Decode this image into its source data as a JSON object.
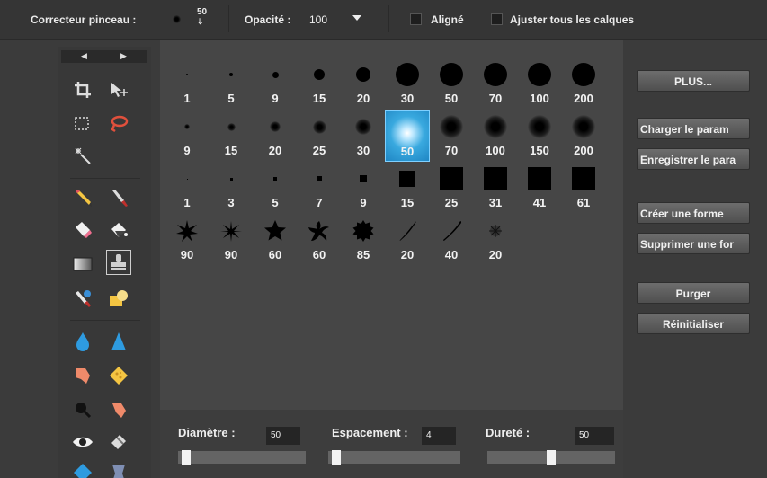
{
  "options_bar": {
    "brush_label": "Correcteur pinceau :",
    "brush_size": "50",
    "brush_size_arrow": "⇓",
    "opacity_label": "Opacité :",
    "opacity_value": "100",
    "aligned_label": "Aligné",
    "aligned_checked": false,
    "all_layers_label": "Ajuster tous les calques",
    "all_layers_checked": false
  },
  "tools_panel": {
    "arrow_left": "◀",
    "arrow_right": "▶",
    "tools": [
      "crop-icon",
      "move-icon",
      "marquee-icon",
      "lasso-icon",
      "magic-wand-icon",
      "pencil-icon",
      "brush-icon",
      "eraser-icon",
      "paint-bucket-icon",
      "gradient-icon",
      "clone-stamp-icon",
      "color-replace-icon",
      "shape-icon",
      "blur-drop-icon",
      "sharpen-icon",
      "smudge-hand-icon",
      "sponge-icon",
      "dodge-icon",
      "burn-icon",
      "red-eye-icon",
      "spot-heal-icon"
    ],
    "selected_tool": "clone-stamp-icon"
  },
  "brushes": {
    "rows": [
      {
        "kind": "hard-round",
        "sizes": [
          "1",
          "5",
          "9",
          "15",
          "20",
          "30",
          "50",
          "70",
          "100",
          "200"
        ]
      },
      {
        "kind": "soft-round",
        "sizes": [
          "9",
          "15",
          "20",
          "25",
          "30",
          "50",
          "70",
          "100",
          "150",
          "200"
        ]
      },
      {
        "kind": "square",
        "sizes": [
          "1",
          "3",
          "5",
          "7",
          "9",
          "15",
          "25",
          "31",
          "41",
          "61"
        ]
      },
      {
        "kind": "special",
        "sizes": [
          "90",
          "90",
          "60",
          "60",
          "85",
          "20",
          "40",
          "20"
        ]
      }
    ],
    "selected": {
      "row": 1,
      "index": 5
    }
  },
  "params": {
    "diameter_label": "Diamètre :",
    "diameter_value": "50",
    "diameter_fraction": 0.0,
    "spacing_label": "Espacement :",
    "spacing_value": "4",
    "spacing_fraction": 0.0,
    "hardness_label": "Dureté :",
    "hardness_value": "50",
    "hardness_fraction": 0.5
  },
  "buttons": {
    "more": "PLUS...",
    "load": "Charger le param",
    "save": "Enregistrer le para",
    "create": "Créer une forme",
    "delete": "Supprimer une for",
    "purge": "Purger",
    "reset": "Réinitialiser"
  },
  "colors": {
    "selection": "#2a9ad6",
    "panel": "#464646",
    "background": "#3b3b3b"
  }
}
